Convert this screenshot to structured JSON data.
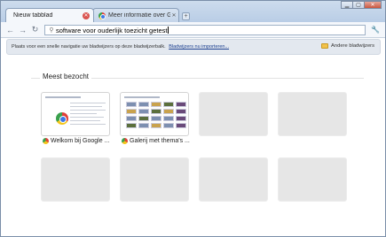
{
  "tabs": [
    {
      "label": "Nieuw tabblad",
      "active": true
    },
    {
      "label": "Meer informatie over Go...",
      "active": false
    }
  ],
  "toolbar": {
    "omnibox_value": "software voor ouderlijk toezicht getest"
  },
  "bookmarks_bar": {
    "message": "Plaats voor een snelle navigatie uw bladwijzers op deze bladwijzerbalk.",
    "import_link": "Bladwijzers nu importeren...",
    "other_bookmarks": "Andere bladwijzers"
  },
  "most_visited": {
    "title": "Meest bezocht",
    "items": [
      {
        "caption": "Welkom bij Google ...",
        "filled": true
      },
      {
        "caption": "Galerij met thema's ...",
        "filled": true
      },
      {
        "caption": "",
        "filled": false
      },
      {
        "caption": "",
        "filled": false
      },
      {
        "caption": "",
        "filled": false
      },
      {
        "caption": "",
        "filled": false
      },
      {
        "caption": "",
        "filled": false
      },
      {
        "caption": "",
        "filled": false
      }
    ]
  },
  "colors": {
    "frame": "#b9cde6",
    "accent_red": "#d9534f",
    "link": "#1b3f8f"
  }
}
